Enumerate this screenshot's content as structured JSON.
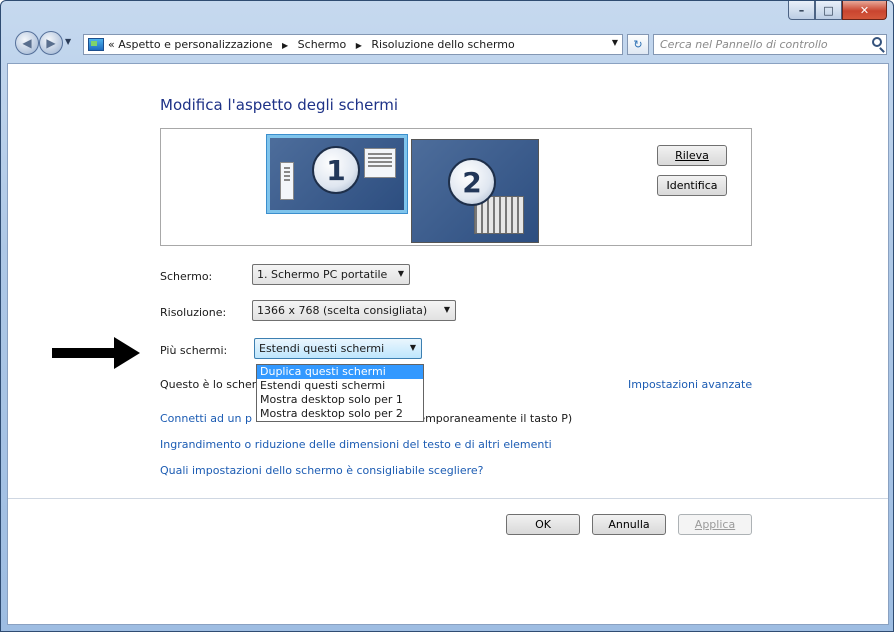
{
  "window": {
    "caption_buttons": {
      "minimize": "–",
      "maximize": "□",
      "close": "✕"
    }
  },
  "navbar": {
    "breadcrumb_prefix": "«",
    "breadcrumbs": [
      "Aspetto e personalizzazione",
      "Schermo",
      "Risoluzione dello schermo"
    ],
    "search_placeholder": "Cerca nel Pannello di controllo"
  },
  "page": {
    "title": "Modifica l'aspetto degli schermi",
    "monitors": [
      "1",
      "2"
    ],
    "detect_button": "Rileva",
    "identify_button": "Identifica",
    "display_label": "Schermo:",
    "display_value": "1. Schermo PC portatile",
    "resolution_label": "Risoluzione:",
    "resolution_value": "1366 x 768 (scelta consigliata)",
    "multiple_label": "Più schermi:",
    "multiple_value": "Estendi questi schermi",
    "multiple_options": [
      "Duplica questi schermi",
      "Estendi questi schermi",
      "Mostra desktop solo per 1",
      "Mostra desktop solo per 2"
    ],
    "main_display_text": "Questo è lo scher",
    "advanced_link": "Impostazioni avanzate",
    "connect_link": "Connetti ad un p",
    "connect_suffix": "temporaneamente il tasto P)",
    "text_size_link": "Ingrandimento o riduzione delle dimensioni del testo e di altri elementi",
    "which_settings_link": "Quali impostazioni dello schermo è consigliabile scegliere?",
    "ok_button": "OK",
    "cancel_button": "Annulla",
    "apply_button": "Applica"
  },
  "icons": {
    "back": "back-arrow-icon",
    "forward": "forward-arrow-icon",
    "refresh": "refresh-icon",
    "search": "search-icon",
    "pointer": "right-arrow-icon"
  },
  "colors": {
    "title": "#1e3287",
    "link": "#1c5cb3",
    "selection": "#3399ff"
  }
}
